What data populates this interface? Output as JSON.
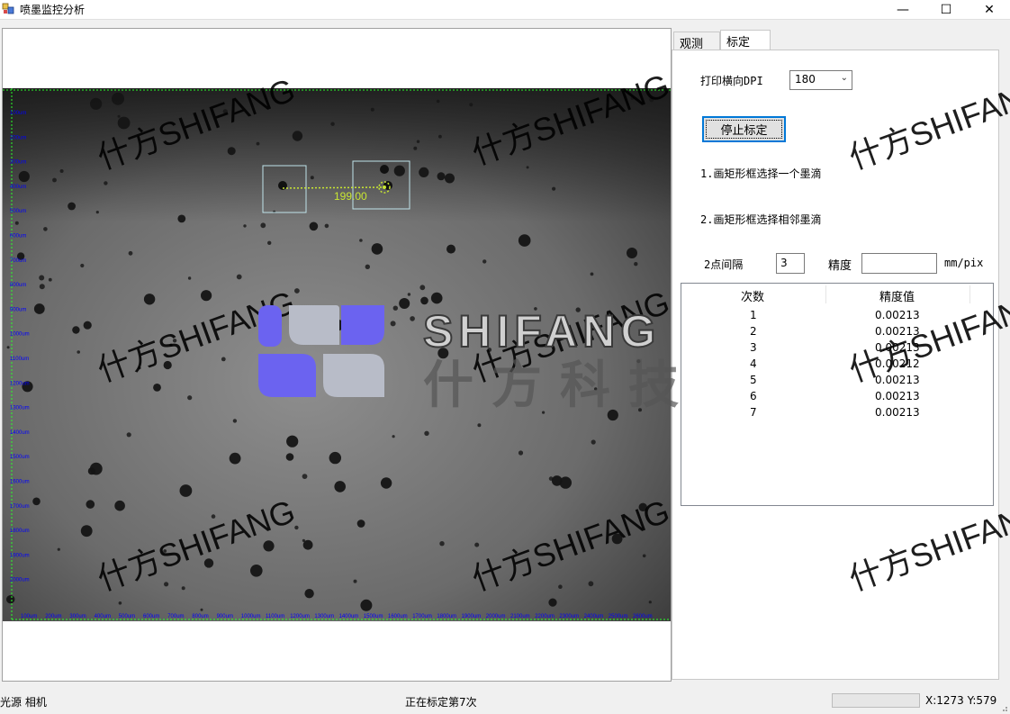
{
  "window": {
    "title": "喷墨监控分析"
  },
  "titlebar_buttons": {
    "minimize": "—",
    "maximize": "☐",
    "close": "✕"
  },
  "tabs": [
    {
      "label": "观测",
      "active": false
    },
    {
      "label": "标定",
      "active": true
    }
  ],
  "calibration": {
    "dpi_label": "打印横向DPI",
    "dpi_value": "180",
    "stop_button": "停止标定",
    "step1": "1.画矩形框选择一个墨滴",
    "step2": "2.画矩形框选择相邻墨滴",
    "spacing_label": "2点间隔",
    "spacing_value": "3",
    "precision_label": "精度",
    "precision_value": "",
    "unit": "mm/pix"
  },
  "results_table": {
    "headers": [
      "次数",
      "精度值"
    ],
    "rows": [
      [
        "1",
        "0.00213"
      ],
      [
        "2",
        "0.00213"
      ],
      [
        "3",
        "0.00213"
      ],
      [
        "4",
        "0.00212"
      ],
      [
        "5",
        "0.00213"
      ],
      [
        "6",
        "0.00213"
      ],
      [
        "7",
        "0.00213"
      ]
    ]
  },
  "measurement": {
    "distance_label": "199.00"
  },
  "ruler": {
    "x_ticks": [
      "100um",
      "200um",
      "300um",
      "400um",
      "500um",
      "600um",
      "700um",
      "800um",
      "900um",
      "1000um",
      "1100um",
      "1200um",
      "1300um",
      "1400um",
      "1500um",
      "1600um",
      "1700um",
      "1800um",
      "1900um",
      "2000um",
      "2100um",
      "2200um",
      "2300um",
      "2400um",
      "2500um",
      "2600um"
    ],
    "y_ticks": [
      "100um",
      "200um",
      "300um",
      "400um",
      "500um",
      "600um",
      "700um",
      "800um",
      "900um",
      "1000um",
      "1100um",
      "1200um",
      "1300um",
      "1400um",
      "1500um",
      "1600um",
      "1700um",
      "1800um",
      "1900um",
      "2000um"
    ]
  },
  "statusbar": {
    "left": "光源  相机",
    "center": "正在标定第7次",
    "coords": "X:1273 Y:579",
    "progress": 0
  },
  "watermark": {
    "text": "什方SHIFANG",
    "logo_text_en": "SHIFANG",
    "logo_text_cn": "什方科技"
  },
  "colors": {
    "ruler": "#0000ff",
    "measure": "#c8e632",
    "selection": "#bfe3ea",
    "logo_purple": "#6b63f0",
    "logo_gray": "#b8bcc8"
  }
}
